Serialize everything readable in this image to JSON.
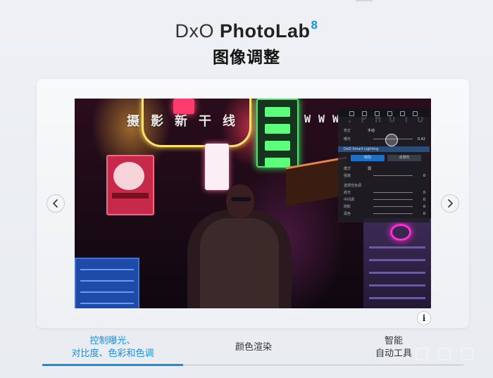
{
  "brand": {
    "prefix": "DxO",
    "name": "PhotoLab",
    "version": "8",
    "subtitle": "图像调整"
  },
  "watermarks": {
    "cn": "摄影新干线",
    "en": "WWW.PHOTOSKS"
  },
  "panel": {
    "rows": [
      {
        "label": "校正",
        "value": "手动"
      },
      {
        "label": "曝光",
        "value": "0.42"
      }
    ],
    "section": "DxO Smart Lighting",
    "buttons": [
      "均匀",
      "点测光"
    ],
    "rows2": [
      {
        "label": "模式",
        "value": "弱"
      },
      {
        "label": "强度",
        "value": "0"
      }
    ],
    "section2": "选择性色调",
    "tone_rows": [
      {
        "label": "高光",
        "value": "0"
      },
      {
        "label": "中间调",
        "value": "0"
      },
      {
        "label": "阴影",
        "value": "0"
      },
      {
        "label": "黑色",
        "value": "0"
      }
    ]
  },
  "carousel": {
    "prev_icon": "chevron-left-icon",
    "next_icon": "chevron-right-icon",
    "info_label": "i"
  },
  "tabs": [
    {
      "line1": "控制曝光、",
      "line2": "对比度、色彩和色调",
      "active": true
    },
    {
      "line1": "颜色渲染",
      "line2": "",
      "active": false
    },
    {
      "line1": "智能",
      "line2": "自动工具",
      "active": false
    }
  ],
  "colors": {
    "accent": "#1a8ed8",
    "text": "#222222",
    "background": "#eceff3"
  }
}
